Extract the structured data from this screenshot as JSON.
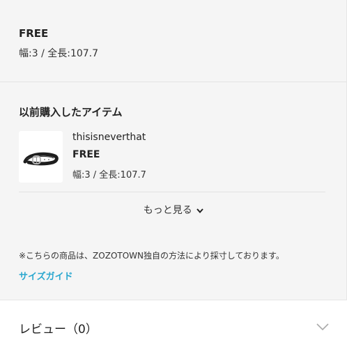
{
  "size_info": {
    "size_name": "FREE",
    "size_detail": "幅:3 / 全長:107.7"
  },
  "past_purchases": {
    "title": "以前購入したアイテム",
    "items": [
      {
        "brand": "thisisneverthat",
        "size_name": "FREE",
        "size_detail": "幅:3 / 全長:107.7",
        "thumbnail_icon": "belt-icon"
      }
    ],
    "more_label": "もっと見る"
  },
  "note": "※こちらの商品は、ZOZOTOWN独自の方法により採寸しております。",
  "size_guide_label": "サイズガイド",
  "review": {
    "label": "レビュー（0）"
  },
  "colors": {
    "link": "#2aa7cf",
    "background": "#f5f5f5"
  }
}
